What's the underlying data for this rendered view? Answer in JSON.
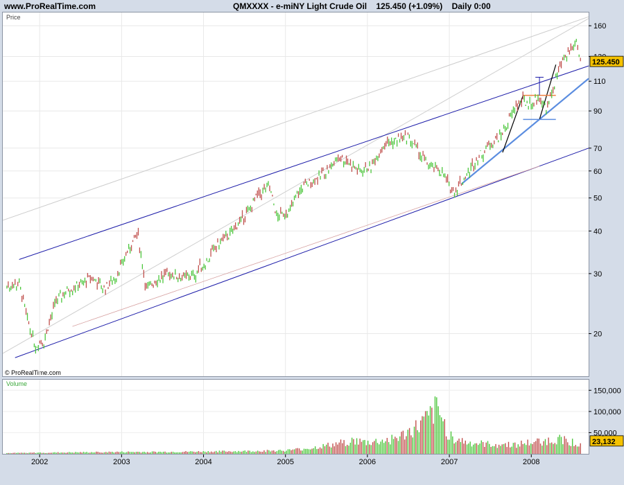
{
  "header": {
    "site": "www.ProRealTime.com",
    "symbol": "QMXXXX - e-miNY Light Crude Oil",
    "price": "125.450 (+1.09%)",
    "period": "Daily 0:00"
  },
  "price_panel": {
    "label": "Price",
    "watermark": "© ProRealTime.com"
  },
  "volume_panel": {
    "label": "Volume"
  },
  "colors": {
    "up": "#4cc63c",
    "down": "#c0504d",
    "channel": "#1a1aa8",
    "support": "#5b8de0",
    "badge": "#f5c200"
  },
  "chart_data": [
    {
      "type": "candlestick",
      "title": "",
      "ylabel": "Price",
      "yscale": "log",
      "ylim": [
        15,
        175
      ],
      "y_ticks": [
        20,
        30,
        40,
        50,
        60,
        70,
        90,
        110,
        130,
        160
      ],
      "x_ticks": [
        "2002",
        "2003",
        "2004",
        "2005",
        "2006",
        "2007",
        "2008"
      ],
      "last_price_label": "125.450",
      "x": [
        2001.6,
        2001.75,
        2001.85,
        2001.95,
        2002.05,
        2002.2,
        2002.35,
        2002.5,
        2002.65,
        2002.8,
        2002.95,
        2003.1,
        2003.2,
        2003.3,
        2003.45,
        2003.6,
        2003.75,
        2003.9,
        2004.05,
        2004.2,
        2004.35,
        2004.5,
        2004.65,
        2004.8,
        2004.9,
        2005.05,
        2005.2,
        2005.35,
        2005.5,
        2005.65,
        2005.75,
        2005.9,
        2006.05,
        2006.2,
        2006.35,
        2006.5,
        2006.6,
        2006.75,
        2006.9,
        2007.0,
        2007.05,
        2007.2,
        2007.35,
        2007.5,
        2007.65,
        2007.8,
        2007.9,
        2008.0,
        2008.1,
        2008.2,
        2008.3,
        2008.4,
        2008.5,
        2008.55,
        2008.6
      ],
      "y": [
        27.5,
        28,
        22,
        18.5,
        19,
        25,
        27,
        28,
        29,
        27,
        30,
        36,
        39,
        27,
        29,
        30,
        29,
        30,
        33,
        37,
        40,
        44,
        50,
        54,
        44,
        46,
        54,
        56,
        60,
        66,
        64,
        60,
        62,
        72,
        74,
        76,
        70,
        62,
        60,
        54,
        52,
        58,
        66,
        72,
        78,
        92,
        96,
        95,
        98,
        92,
        112,
        128,
        138,
        145,
        125.45
      ]
    },
    {
      "type": "bar",
      "title": "",
      "ylabel": "Volume",
      "ylim": [
        0,
        175000
      ],
      "y_ticks": [
        50000,
        100000,
        150000
      ],
      "y_tick_labels": [
        "50,000",
        "100,000",
        "150,000"
      ],
      "last_volume_label": "23,132",
      "x": [
        2001.6,
        2002.0,
        2002.5,
        2003.0,
        2003.5,
        2004.0,
        2004.5,
        2005.0,
        2005.3,
        2005.6,
        2005.8,
        2006.0,
        2006.2,
        2006.4,
        2006.6,
        2006.75,
        2006.85,
        2007.0,
        2007.2,
        2007.5,
        2007.8,
        2008.0,
        2008.2,
        2008.4,
        2008.6
      ],
      "values": [
        2000,
        3000,
        4000,
        5000,
        5000,
        6000,
        7000,
        9000,
        15000,
        25000,
        35000,
        30000,
        35000,
        45000,
        70000,
        95000,
        120000,
        50000,
        30000,
        25000,
        25000,
        30000,
        35000,
        40000,
        23132
      ]
    }
  ]
}
